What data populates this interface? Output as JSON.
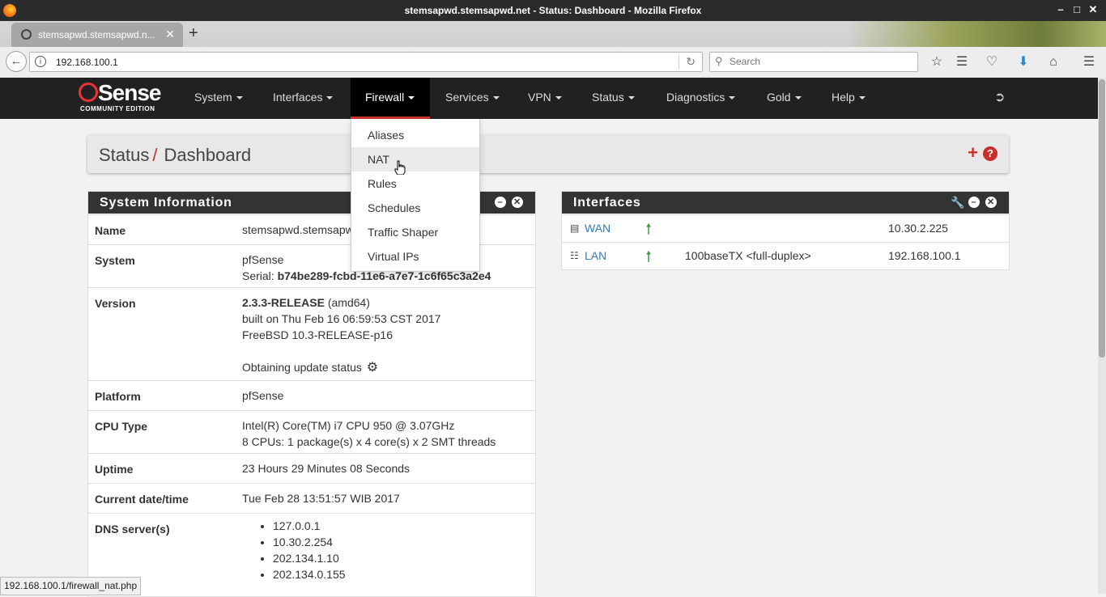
{
  "window": {
    "title": "stemsapwd.stemsapwd.net - Status: Dashboard - Mozilla Firefox",
    "minimize": "–",
    "maximize": "□",
    "close": "✕"
  },
  "tab": {
    "label": "stemsapwd.stemsapwd.n...",
    "close": "✕",
    "new": "+"
  },
  "navbar": {
    "url": "192.168.100.1",
    "search_placeholder": "Search"
  },
  "pf": {
    "logo_word": "Sense",
    "logo_edition": "COMMUNITY EDITION",
    "menu": [
      "System",
      "Interfaces",
      "Firewall",
      "Services",
      "VPN",
      "Status",
      "Diagnostics",
      "Gold",
      "Help"
    ],
    "active_menu": "Firewall",
    "firewall_dropdown": [
      "Aliases",
      "NAT",
      "Rules",
      "Schedules",
      "Traffic Shaper",
      "Virtual IPs"
    ]
  },
  "breadcrumb": {
    "section": "Status",
    "sep": "/",
    "page": "Dashboard"
  },
  "system_info": {
    "title": "System Information",
    "name_label": "Name",
    "name_value": "stemsapwd.stemsapwd.net",
    "system_label": "System",
    "system_value": "pfSense",
    "serial_label": "Serial:",
    "serial_value": "b74be289-fcbd-11e6-a7e7-1c6f65c3a2e4",
    "version_label": "Version",
    "version_release": "2.3.3-RELEASE",
    "version_arch": "(amd64)",
    "version_built": "built on Thu Feb 16 06:59:53 CST 2017",
    "version_freebsd": "FreeBSD 10.3-RELEASE-p16",
    "update_status": "Obtaining update status",
    "platform_label": "Platform",
    "platform_value": "pfSense",
    "cpu_label": "CPU Type",
    "cpu_line1": "Intel(R) Core(TM) i7 CPU 950 @ 3.07GHz",
    "cpu_line2": "8 CPUs: 1 package(s) x 4 core(s) x 2 SMT threads",
    "uptime_label": "Uptime",
    "uptime_value": "23 Hours 29 Minutes 08 Seconds",
    "datetime_label": "Current date/time",
    "datetime_value": "Tue Feb 28 13:51:57 WIB 2017",
    "dns_label": "DNS server(s)",
    "dns": [
      "127.0.0.1",
      "10.30.2.254",
      "202.134.1.10",
      "202.134.0.155"
    ]
  },
  "interfaces": {
    "title": "Interfaces",
    "rows": [
      {
        "name": "WAN",
        "media": "",
        "ip": "10.30.2.225"
      },
      {
        "name": "LAN",
        "media": "100baseTX <full-duplex>",
        "ip": "192.168.100.1"
      }
    ]
  },
  "statusbar": "192.168.100.1/firewall_nat.php",
  "colors": {
    "accent": "#c9302c",
    "nav_bg": "#212121",
    "link": "#337ab7",
    "status_up": "#3c9b3c"
  }
}
